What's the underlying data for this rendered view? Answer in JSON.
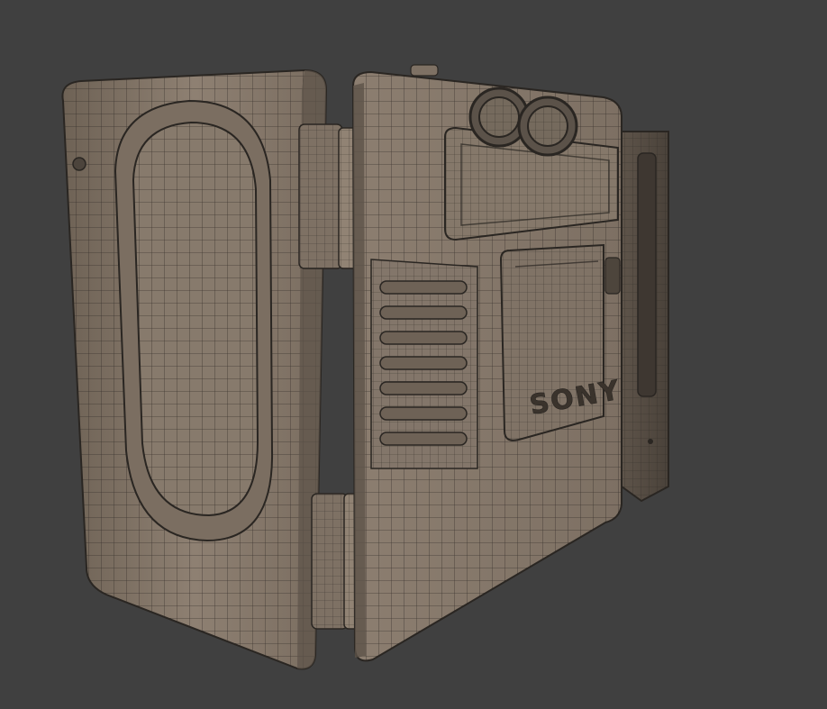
{
  "viewport": {
    "background": "#404040",
    "surface_color": "#8a7c6e",
    "surface_shade": "#6b5f53",
    "wire_color": "#2a2622"
  },
  "model": {
    "subject": "wireframe-cassette-player",
    "brand_logo_text": "SONY",
    "render_mode": "wireframe-over-shaded"
  }
}
